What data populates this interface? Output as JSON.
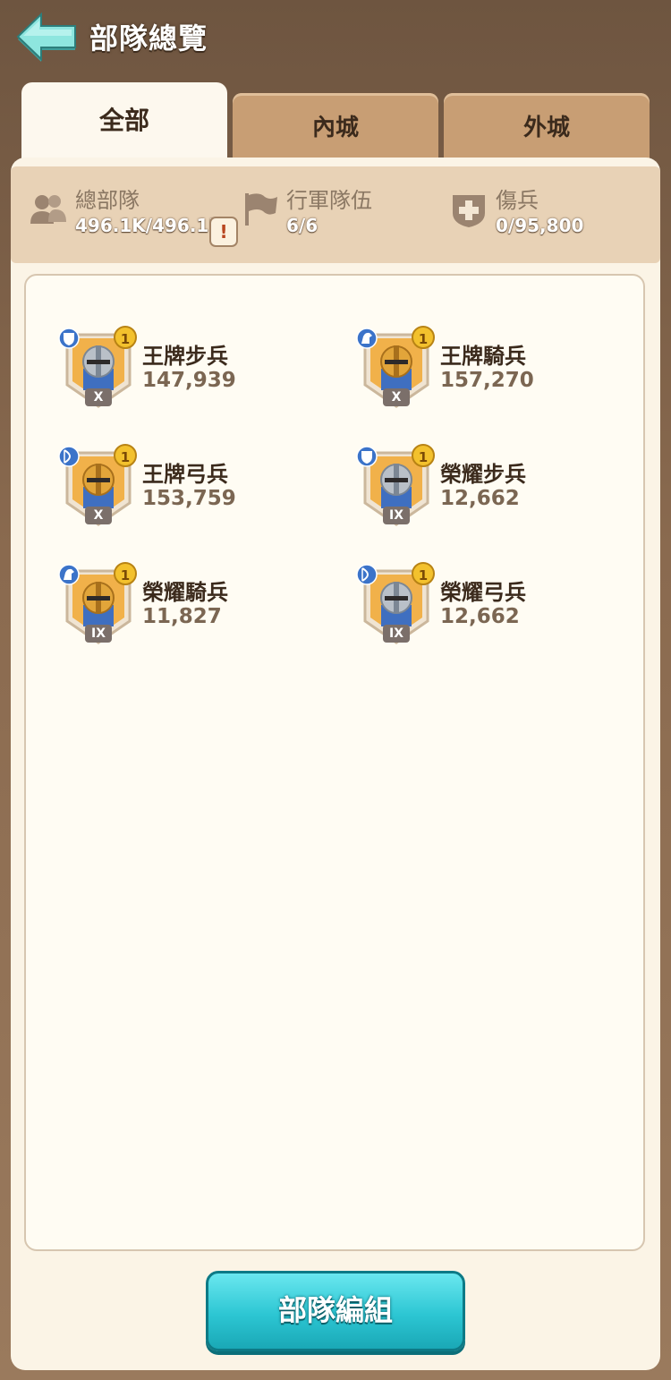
{
  "header": {
    "title": "部隊總覽"
  },
  "tabs": [
    {
      "label": "全部",
      "active": true
    },
    {
      "label": "內城",
      "active": false
    },
    {
      "label": "外城",
      "active": false
    }
  ],
  "stats": {
    "total": {
      "label": "總部隊",
      "value": "496.1K/496.1K",
      "icon": "troops-icon"
    },
    "march": {
      "label": "行軍隊伍",
      "value": "6/6",
      "icon": "flag-icon"
    },
    "wounded": {
      "label": "傷兵",
      "value": "0/95,800",
      "icon": "medical-cross-icon"
    },
    "warning_badge": "!"
  },
  "units": [
    {
      "name": "王牌步兵",
      "count": "147,939",
      "tier": "X",
      "type": "infantry",
      "armor": "silver",
      "level_badge": "1"
    },
    {
      "name": "王牌騎兵",
      "count": "157,270",
      "tier": "X",
      "type": "cavalry",
      "armor": "gold",
      "level_badge": "1"
    },
    {
      "name": "王牌弓兵",
      "count": "153,759",
      "tier": "X",
      "type": "archer",
      "armor": "gold",
      "level_badge": "1"
    },
    {
      "name": "榮耀步兵",
      "count": "12,662",
      "tier": "IX",
      "type": "infantry",
      "armor": "silver",
      "level_badge": "1"
    },
    {
      "name": "榮耀騎兵",
      "count": "11,827",
      "tier": "IX",
      "type": "cavalry",
      "armor": "gold",
      "level_badge": "1"
    },
    {
      "name": "榮耀弓兵",
      "count": "12,662",
      "tier": "IX",
      "type": "archer",
      "armor": "silver",
      "level_badge": "1"
    }
  ],
  "footer": {
    "button_label": "部隊編組"
  },
  "colors": {
    "accent": "#2cc6d3",
    "panel": "#fbf4e6",
    "tab_inactive": "#c89e74",
    "background": "#7a5e46"
  }
}
